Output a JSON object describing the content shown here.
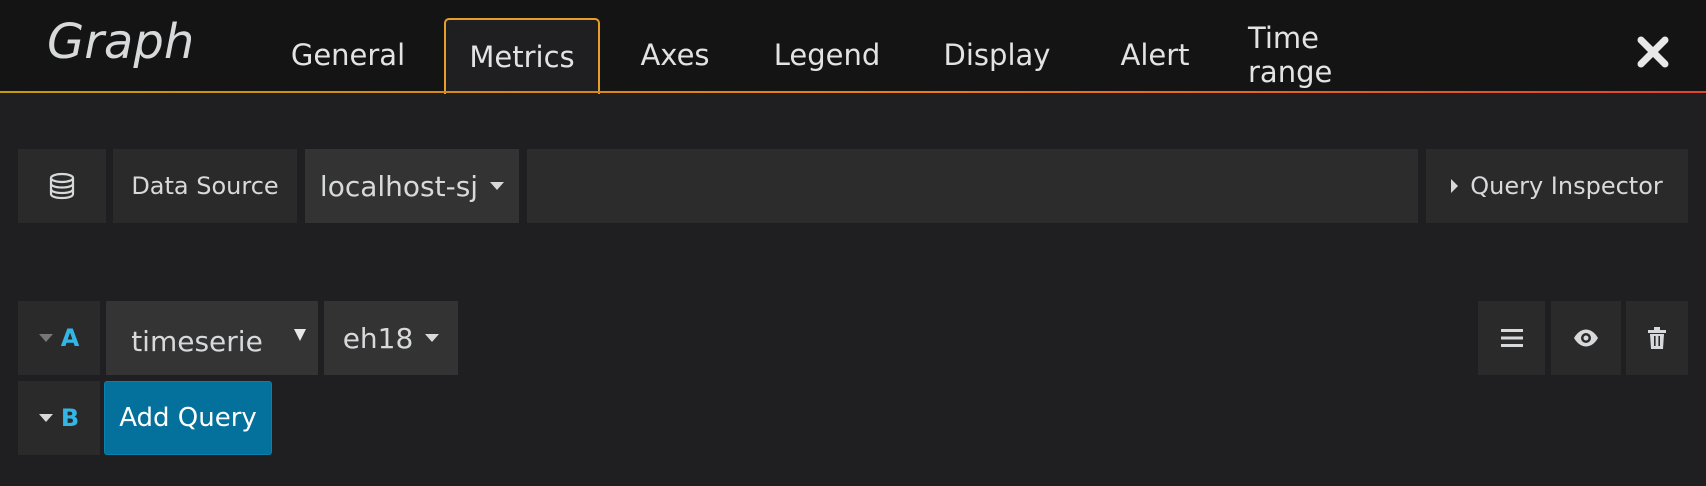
{
  "header": {
    "title": "Graph",
    "tabs": [
      {
        "label": "General"
      },
      {
        "label": "Metrics"
      },
      {
        "label": "Axes"
      },
      {
        "label": "Legend"
      },
      {
        "label": "Display"
      },
      {
        "label": "Alert"
      },
      {
        "label": "Time range"
      }
    ],
    "active_tab": "Metrics",
    "close_icon": "close-icon"
  },
  "datasource_bar": {
    "icon": "database-icon",
    "label": "Data Source",
    "selected": "localhost-sj",
    "inspector_label": "Query Inspector"
  },
  "queries": [
    {
      "letter": "A",
      "type": "timeserie",
      "target": "eh18"
    },
    {
      "letter": "B",
      "add_label": "Add Query"
    }
  ],
  "colors": {
    "accent": "#e89f2a",
    "letter": "#33b5e5",
    "button_primary": "#04709c"
  }
}
